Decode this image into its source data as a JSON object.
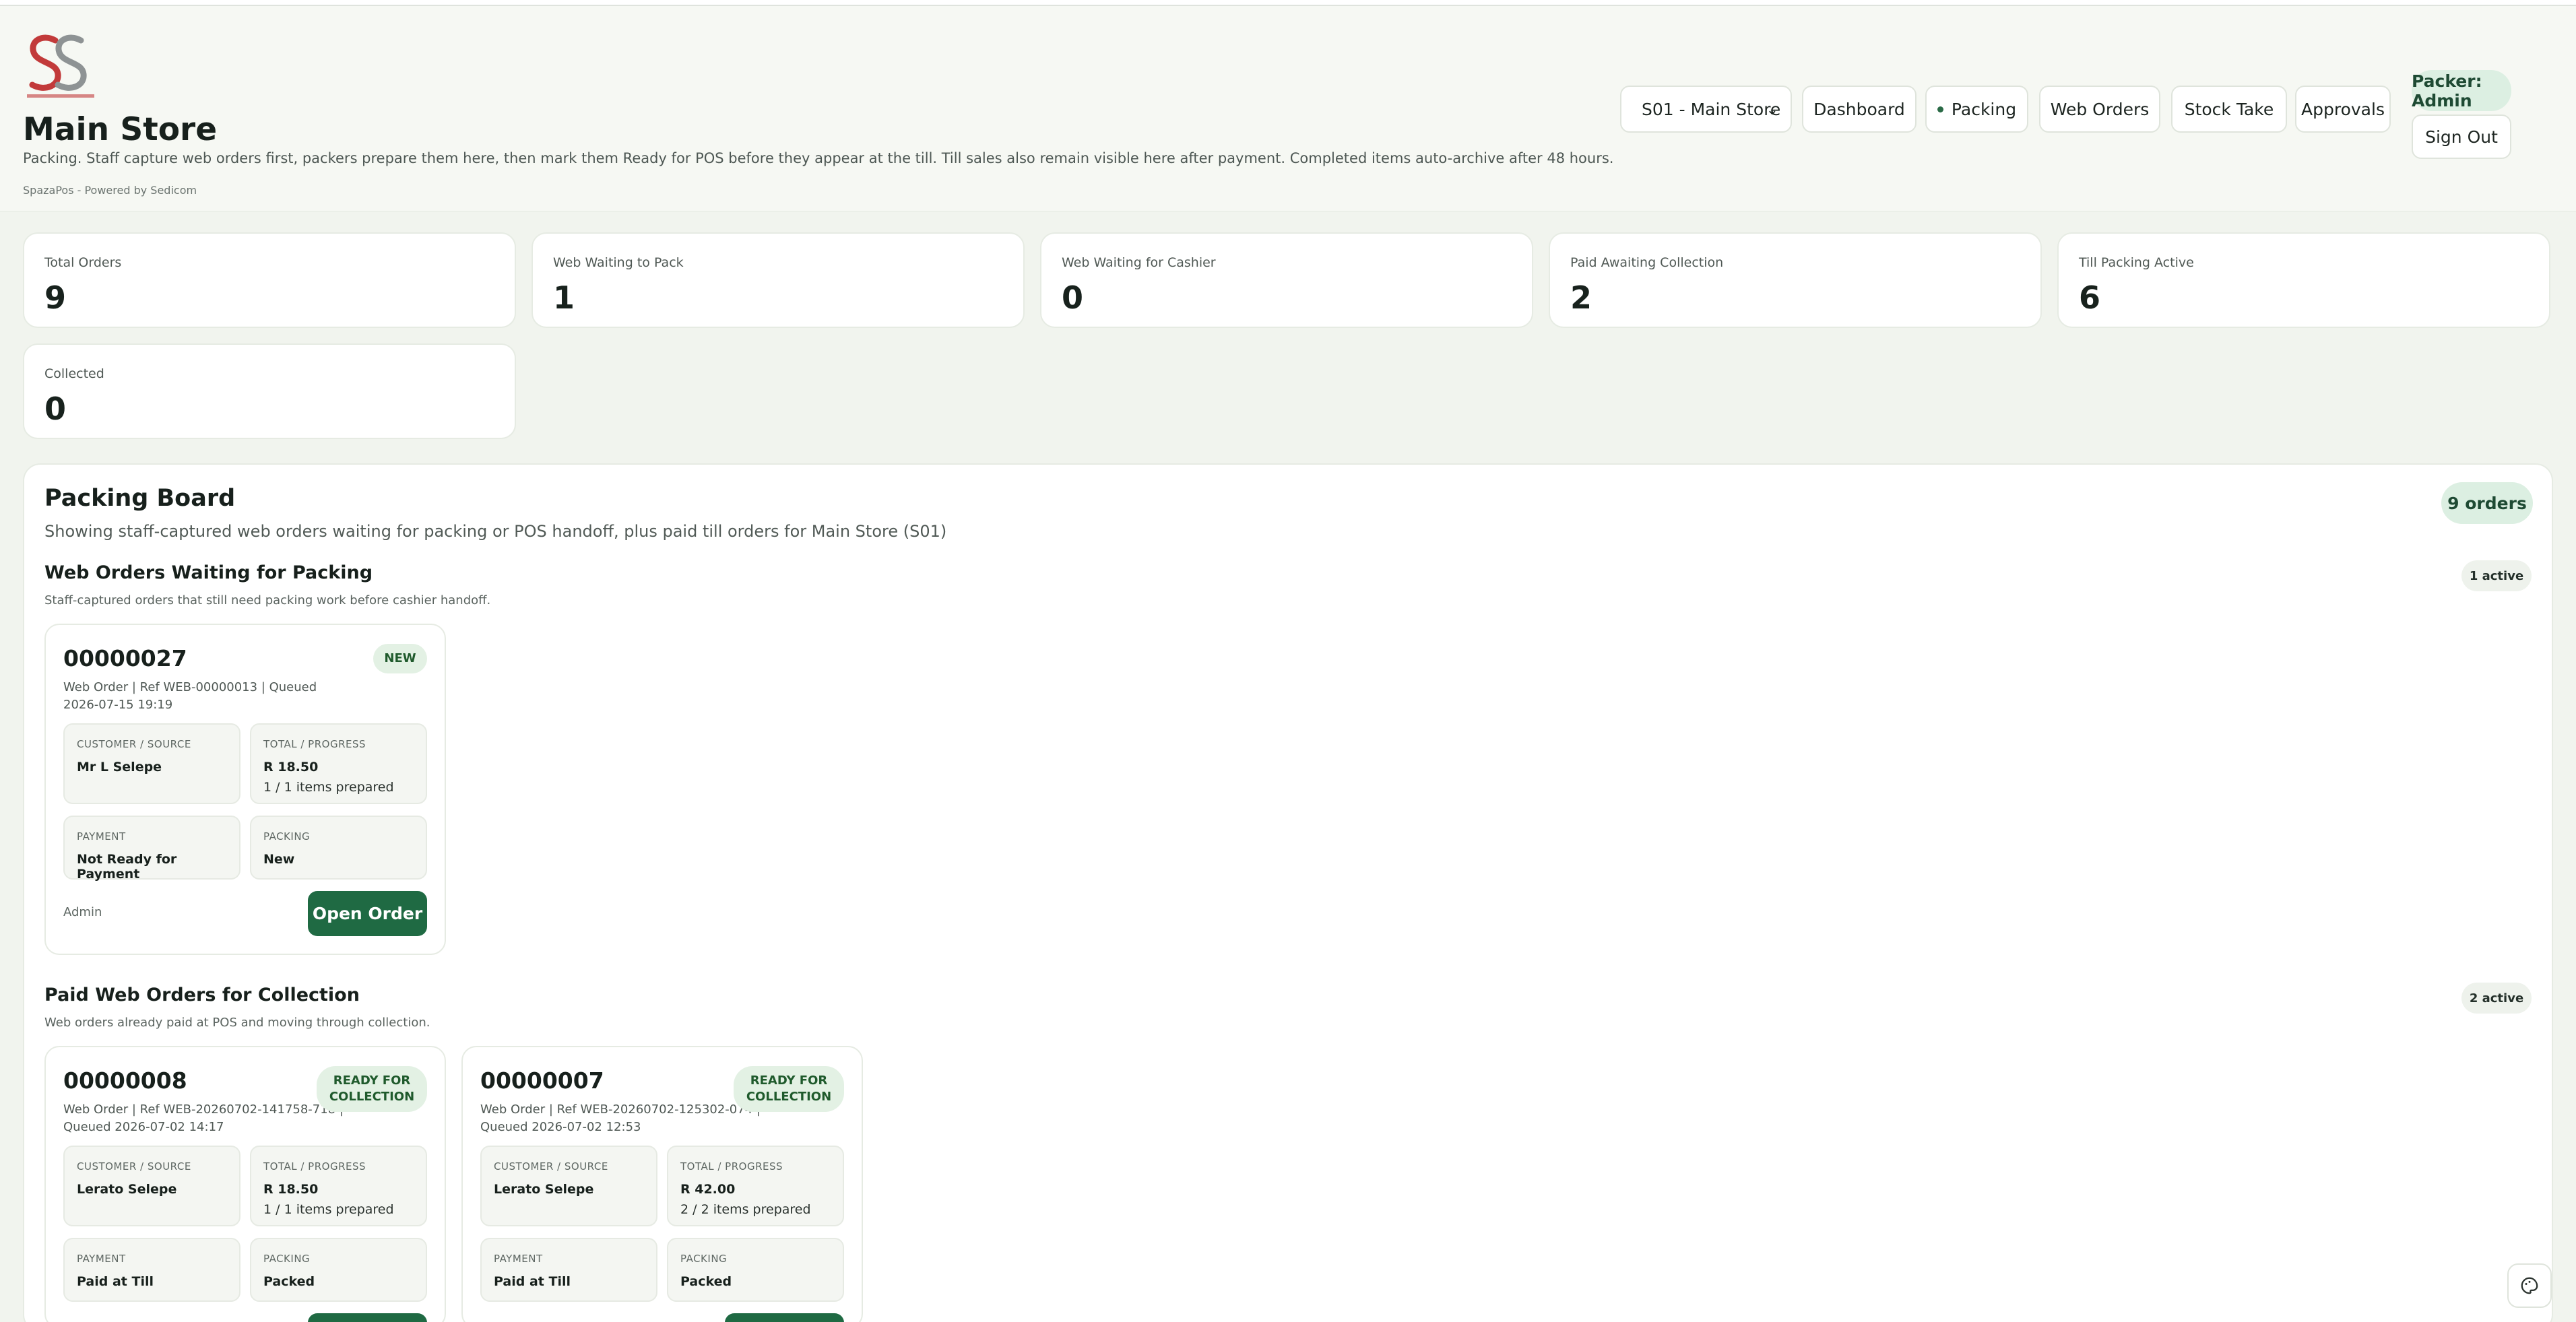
{
  "header": {
    "logo_text": "SS",
    "store_title": "Main Store",
    "description": "Packing. Staff capture web orders first, packers prepare them here, then mark them Ready for POS before they appear at the till. Till sales also remain visible here after payment. Completed items auto-archive after 48 hours.",
    "powered_by": "SpazaPos - Powered by Sedicom"
  },
  "nav": {
    "store_select": "S01 - Main Store",
    "dashboard": "Dashboard",
    "packing": "Packing",
    "web_orders": "Web Orders",
    "stock_take": "Stock Take",
    "approvals": "Approvals",
    "packer": "Packer: Admin",
    "sign_out": "Sign Out"
  },
  "stats": [
    {
      "label": "Total Orders",
      "value": "9"
    },
    {
      "label": "Web Waiting to Pack",
      "value": "1"
    },
    {
      "label": "Web Waiting for Cashier",
      "value": "0"
    },
    {
      "label": "Paid Awaiting Collection",
      "value": "2"
    },
    {
      "label": "Till Packing Active",
      "value": "6"
    },
    {
      "label": "Collected",
      "value": "0"
    }
  ],
  "board": {
    "title": "Packing Board",
    "subtitle": "Showing staff-captured web orders waiting for packing or POS handoff, plus paid till orders for Main Store (S01)",
    "orders_count": "9 orders",
    "sections": [
      {
        "title": "Web Orders Waiting for Packing",
        "subtitle": "Staff-captured orders that still need packing work before cashier handoff.",
        "active": "1 active",
        "orders": [
          {
            "id": "00000027",
            "meta": "Web Order | Ref WEB-00000013 | Queued 2026-07-15 19:19",
            "status": "NEW",
            "customer": "Mr L Selepe",
            "total": "R 18.50",
            "progress": "1 / 1 items prepared",
            "payment": "Not Ready for Payment",
            "packing": "New",
            "owner": "Admin",
            "action": "Open Order"
          }
        ]
      },
      {
        "title": "Paid Web Orders for Collection",
        "subtitle": "Web orders already paid at POS and moving through collection.",
        "active": "2 active",
        "orders": [
          {
            "id": "00000008",
            "meta": "Web Order | Ref WEB-20260702-141758-718 | Queued 2026-07-02 14:17",
            "status": "READY FOR COLLECTION",
            "customer": "Lerato Selepe",
            "total": "R 18.50",
            "progress": "1 / 1 items prepared",
            "payment": "Paid at Till",
            "packing": "Packed"
          },
          {
            "id": "00000007",
            "meta": "Web Order | Ref WEB-20260702-125302-074 | Queued 2026-07-02 12:53",
            "status": "READY FOR COLLECTION",
            "customer": "Lerato Selepe",
            "total": "R 42.00",
            "progress": "2 / 2 items prepared",
            "payment": "Paid at Till",
            "packing": "Packed"
          }
        ]
      }
    ],
    "labels": {
      "customer": "CUSTOMER / SOURCE",
      "total": "TOTAL / PROGRESS",
      "payment": "PAYMENT",
      "packing": "PACKING"
    }
  },
  "icons": {
    "help": "palette-help-icon",
    "chevron": "chevron-down-icon"
  },
  "colors": {
    "accent": "#1f6a43",
    "badge_bg": "#dcefe2",
    "status_bg": "#e3f1e4"
  }
}
